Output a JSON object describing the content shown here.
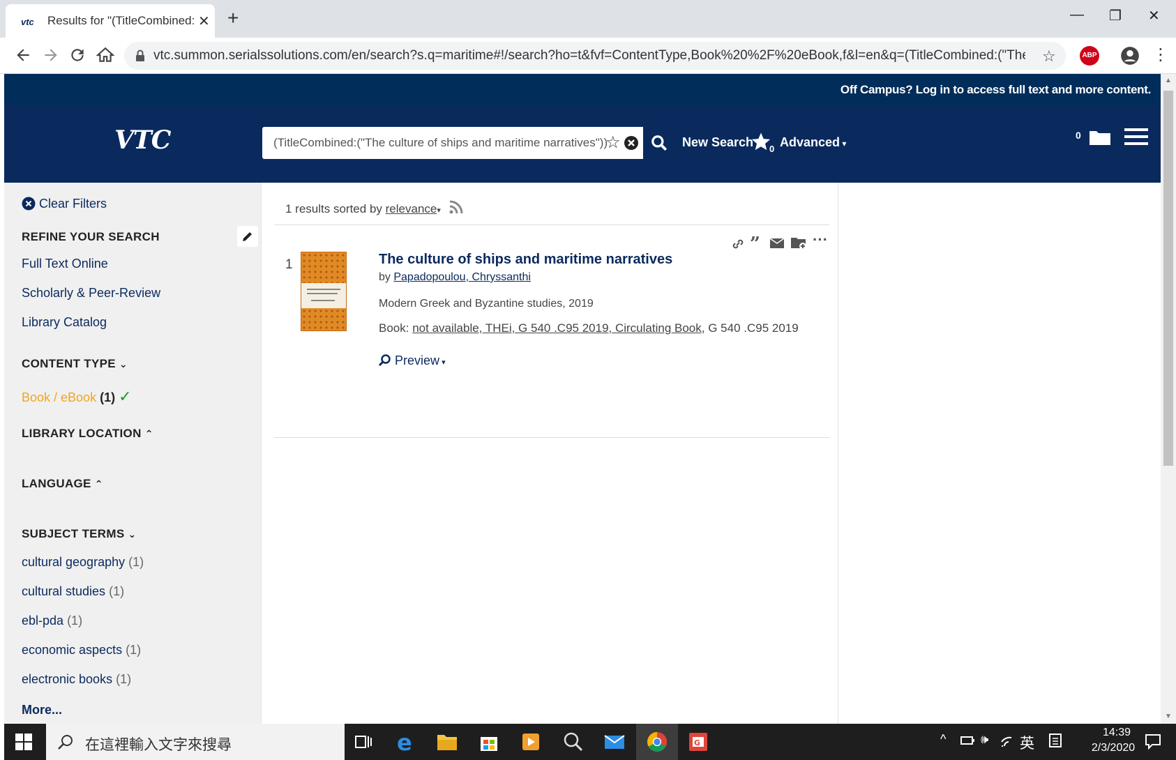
{
  "browser": {
    "tab_title": "Results for \"(TitleCombined:(\"T",
    "tab_favicon": "vtc",
    "url": "vtc.summon.serialssolutions.com/en/search?s.q=maritime#!/search?ho=t&fvf=ContentType,Book%20%2F%20eBook,f&l=en&q=(TitleCombined:(\"The%20...",
    "extension_badge": "ABP"
  },
  "site": {
    "off_campus_text": "Off Campus? Log in to access full text and more content.",
    "logo": "VTC",
    "search_query": "(TitleCombined:(\"The culture of ships and maritime narratives\"))",
    "new_search_label": "New Search",
    "saved_searches_count": "0",
    "advanced_label": "Advanced",
    "folder_count": "0"
  },
  "sidebar": {
    "clear_filters": "Clear Filters",
    "refine_heading": "REFINE YOUR SEARCH",
    "refine_items": [
      "Full Text Online",
      "Scholarly & Peer-Review",
      "Library Catalog"
    ],
    "content_type_heading": "CONTENT TYPE",
    "content_type_selected": {
      "label": "Book / eBook",
      "count": "(1)"
    },
    "library_location_heading": "LIBRARY LOCATION",
    "language_heading": "LANGUAGE",
    "subject_terms_heading": "SUBJECT TERMS",
    "subject_terms": [
      {
        "label": "cultural geography",
        "count": "(1)"
      },
      {
        "label": "cultural studies",
        "count": "(1)"
      },
      {
        "label": "ebl-pda",
        "count": "(1)"
      },
      {
        "label": "economic aspects",
        "count": "(1)"
      },
      {
        "label": "electronic books",
        "count": "(1)"
      }
    ],
    "more_label": "More..."
  },
  "results": {
    "summary_prefix": "1 results sorted by",
    "sort_value": "relevance",
    "items": [
      {
        "number": "1",
        "title": "The culture of ships and maritime narratives",
        "by_label": "by",
        "author": "Papadopoulou, Chryssanthi",
        "publication": "Modern Greek and Byzantine studies, 2019",
        "avail_prefix": "Book:",
        "avail_link": "not available, THEi, G 540 .C95 2019, Circulating Book",
        "avail_suffix": ", G 540 .C95 2019",
        "preview_label": "Preview"
      }
    ]
  },
  "taskbar": {
    "search_placeholder": "在這裡輸入文字來搜尋",
    "ime_label": "英",
    "time": "14:39",
    "date": "2/3/2020"
  }
}
